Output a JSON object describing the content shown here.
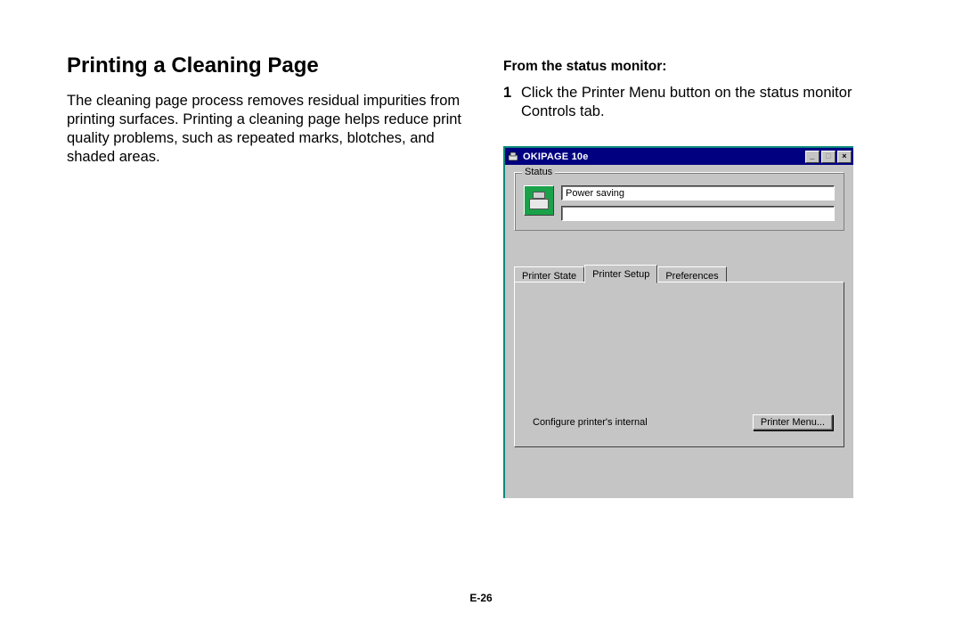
{
  "doc": {
    "heading": "Printing a Cleaning Page",
    "intro": "The cleaning page process removes residual impurities from printing surfaces.  Printing a cleaning page helps reduce print quality problems, such as repeated marks, blotches, and shaded areas.",
    "subhead": "From the status monitor:",
    "step1_num": "1",
    "step1_text": "Click the Printer Menu button on the status monitor Controls tab.",
    "page_number": "E-26"
  },
  "win": {
    "title": "OKIPAGE 10e",
    "min_glyph": "_",
    "max_glyph": "□",
    "close_glyph": "×",
    "status_legend": "Status",
    "status_value": "Power saving",
    "status_value2": "",
    "tabs": {
      "t0": "Printer State",
      "t1": "Printer Setup",
      "t2": "Preferences"
    },
    "config_label": "Configure printer's internal",
    "printer_menu_btn": "Printer Menu..."
  }
}
